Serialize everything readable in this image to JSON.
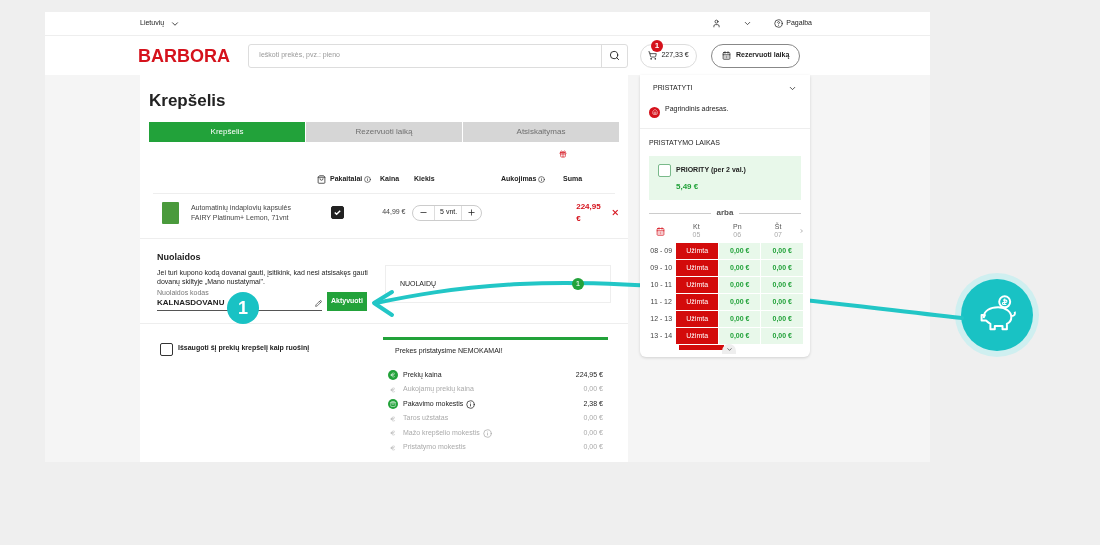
{
  "top_bar": {
    "language": "Lietuvių",
    "help": "Pagalba"
  },
  "header": {
    "logo": "BARBORA",
    "search": {
      "placeholder": "Ieškoti prekės, pvz.: pieno"
    },
    "cart": {
      "count": "1",
      "total": "227,33 €"
    },
    "reserve_button": "Rezervuoti laiką"
  },
  "cart": {
    "title": "Krepšelis",
    "steps": [
      {
        "label": "Krepšelis",
        "selected": true
      },
      {
        "label": "Rezervuoti laiką",
        "selected": false
      },
      {
        "label": "Atsiskaitymas",
        "selected": false
      }
    ],
    "columns": [
      "Pakaitalai",
      "Kaina",
      "Kiekis",
      "Aukojimas",
      "Suma"
    ],
    "items": [
      {
        "name": "Automatinių indaplovių kapsulės",
        "variant": "FAIRY Platinum+ Lemon, 71vnt",
        "substitutes": true,
        "price": "44,99 €",
        "quantity": "5 vnt.",
        "total": "224,95 €"
      }
    ]
  },
  "discounts": {
    "title": "Nuolaidos",
    "note": "Jei turi kupono kodą dovanai gauti, įsitikink, kad nesi atsisakęs gauti dovanų skiltyje „Mano nustatymai\".",
    "code_field": {
      "label": "Nuolaidos kodas",
      "value": "KALNASDOVANU"
    },
    "activate_button": "Aktyvuoti",
    "coupons": {
      "label": "NUOLAIDŲ",
      "count": "1"
    }
  },
  "save_cart": {
    "label": "Išsaugoti šį prekių krepšelį kaip ruošinį",
    "checked": false
  },
  "summary": {
    "banner": "Prekes pristatysime NEMOKAMAI!",
    "rows": [
      {
        "label": "Prekių kaina",
        "value": "224,95 €",
        "active": true,
        "info": false
      },
      {
        "label": "Aukojamų prekių kaina",
        "value": "0,00 €",
        "active": false,
        "info": false
      },
      {
        "label": "Pakavimo mokestis",
        "value": "2,38 €",
        "active": true,
        "info": true
      },
      {
        "label": "Taros užstatas",
        "value": "0,00 €",
        "active": false,
        "info": false
      },
      {
        "label": "Mažo krepšelio mokestis",
        "value": "0,00 €",
        "active": false,
        "info": true
      },
      {
        "label": "Pristatymo mokestis",
        "value": "0,00 €",
        "active": false,
        "info": false
      }
    ]
  },
  "delivery": {
    "title": "PRISTATYTI",
    "address": "Pagrindinis adresas.",
    "time_title": "PRISTATYMO LAIKAS",
    "priority": {
      "label": "PRIORITY (per 2 val.)",
      "price": "5,49 €",
      "checked": false
    },
    "separator": "arba",
    "days": [
      {
        "name": "Kt",
        "date": "05"
      },
      {
        "name": "Pn",
        "date": "06"
      },
      {
        "name": "Št",
        "date": "07"
      }
    ],
    "slots": [
      {
        "time": "08 - 09",
        "cells": [
          {
            "text": "Užimta",
            "available": false
          },
          {
            "text": "0,00 €",
            "available": true
          },
          {
            "text": "0,00 €",
            "available": true
          }
        ]
      },
      {
        "time": "09 - 10",
        "cells": [
          {
            "text": "Užimta",
            "available": false
          },
          {
            "text": "0,00 €",
            "available": true
          },
          {
            "text": "0,00 €",
            "available": true
          }
        ]
      },
      {
        "time": "10 - 11",
        "cells": [
          {
            "text": "Užimta",
            "available": false
          },
          {
            "text": "0,00 €",
            "available": true
          },
          {
            "text": "0,00 €",
            "available": true
          }
        ]
      },
      {
        "time": "11 - 12",
        "cells": [
          {
            "text": "Užimta",
            "available": false
          },
          {
            "text": "0,00 €",
            "available": true
          },
          {
            "text": "0,00 €",
            "available": true
          }
        ]
      },
      {
        "time": "12 - 13",
        "cells": [
          {
            "text": "Užimta",
            "available": false
          },
          {
            "text": "0,00 €",
            "available": true
          },
          {
            "text": "0,00 €",
            "available": true
          }
        ]
      },
      {
        "time": "13 - 14",
        "cells": [
          {
            "text": "Užimta",
            "available": false
          },
          {
            "text": "0,00 €",
            "available": true
          },
          {
            "text": "0,00 €",
            "available": true
          }
        ]
      }
    ]
  },
  "tutorial": {
    "step": "1"
  }
}
